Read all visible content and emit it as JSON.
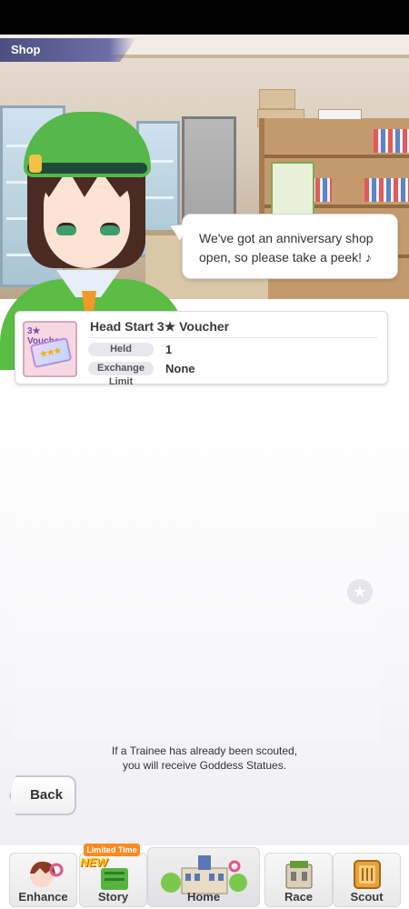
{
  "header": {
    "title": "Shop"
  },
  "speech_bubble": {
    "text": "We've got an anniversary shop open, so please take a peek! ♪"
  },
  "item": {
    "thumbnail_label": "3★ Voucher",
    "thumbnail_stars": "★★★",
    "name": "Head Start 3★ Voucher",
    "held_label": "Held",
    "held_value": "1",
    "exchange_limit_label": "Exchange Limit",
    "exchange_limit_value": "None"
  },
  "star_button_glyph": "★",
  "notice": {
    "line1": "If a Trainee has already been scouted,",
    "line2": "you will receive Goddess Statues."
  },
  "back_button": {
    "label": "Back"
  },
  "nav": {
    "items": [
      {
        "label": "Enhance",
        "icon": "enhance-icon"
      },
      {
        "label": "Story",
        "icon": "story-icon",
        "badge_limited": "Limited Time",
        "badge_new": "NEW"
      },
      {
        "label": "Home",
        "icon": "home-icon"
      },
      {
        "label": "Race",
        "icon": "race-icon"
      },
      {
        "label": "Scout",
        "icon": "scout-icon"
      }
    ]
  },
  "colors": {
    "shop_tag": "#5a5c94",
    "hat_green": "#56b74a",
    "badge_orange": "#ff8a1e"
  }
}
